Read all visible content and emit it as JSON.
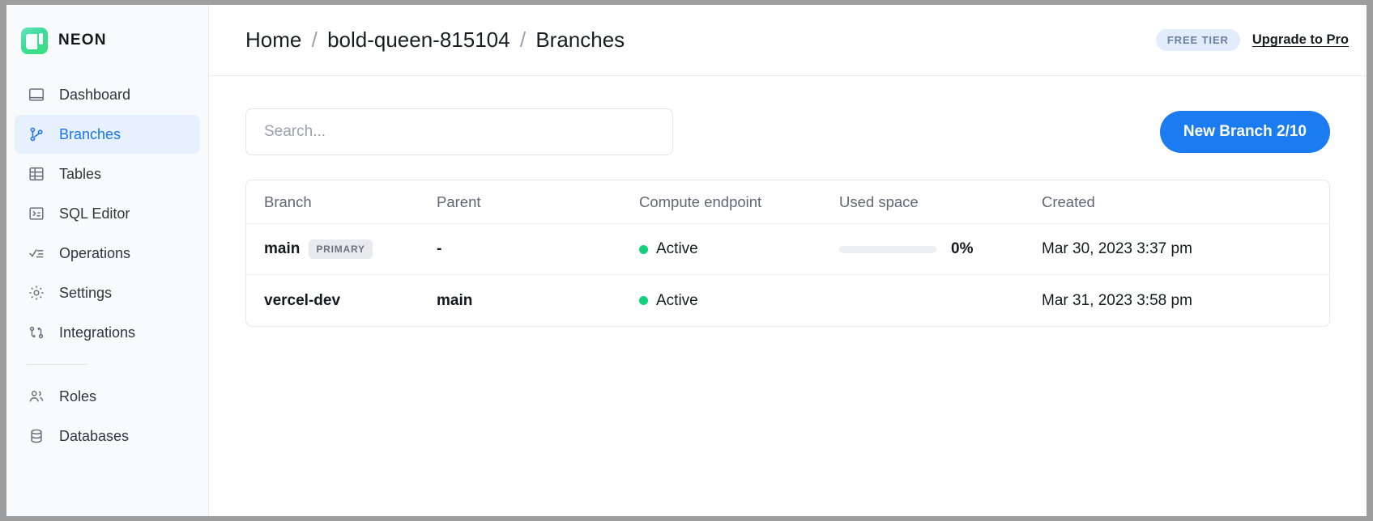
{
  "brand": {
    "name": "NEON",
    "logo_icon": "neon-logo-icon"
  },
  "sidebar": {
    "primary_items": [
      {
        "label": "Dashboard",
        "icon": "dashboard-icon",
        "active": false
      },
      {
        "label": "Branches",
        "icon": "branches-icon",
        "active": true
      },
      {
        "label": "Tables",
        "icon": "tables-icon",
        "active": false
      },
      {
        "label": "SQL Editor",
        "icon": "sql-editor-icon",
        "active": false
      },
      {
        "label": "Operations",
        "icon": "operations-icon",
        "active": false
      },
      {
        "label": "Settings",
        "icon": "gear-icon",
        "active": false
      },
      {
        "label": "Integrations",
        "icon": "integrations-icon",
        "active": false
      }
    ],
    "secondary_items": [
      {
        "label": "Roles",
        "icon": "users-icon",
        "active": false
      },
      {
        "label": "Databases",
        "icon": "database-icon",
        "active": false
      }
    ]
  },
  "topbar": {
    "breadcrumb": [
      "Home",
      "bold-queen-815104",
      "Branches"
    ],
    "separator": "/",
    "tier_badge": "FREE TIER",
    "upgrade_link": "Upgrade to Pro"
  },
  "toolbar": {
    "search_placeholder": "Search...",
    "search_value": "",
    "new_branch_label": "New Branch 2/10"
  },
  "table": {
    "columns": [
      "Branch",
      "Parent",
      "Compute endpoint",
      "Used space",
      "Created"
    ],
    "rows": [
      {
        "branch": "main",
        "badge": "PRIMARY",
        "parent": "-",
        "compute_status": "Active",
        "used_space_percent": 0,
        "used_space_label": "0%",
        "show_usage_bar": true,
        "created": "Mar 30, 2023 3:37 pm"
      },
      {
        "branch": "vercel-dev",
        "badge": "",
        "parent": "main",
        "compute_status": "Active",
        "used_space_percent": 0,
        "used_space_label": "",
        "show_usage_bar": false,
        "created": "Mar 31, 2023 3:58 pm"
      }
    ]
  },
  "colors": {
    "accent_blue": "#1a7cf0",
    "active_nav_bg": "#e6f0ff",
    "status_green": "#13cf7f",
    "brand_green": "#38e07b",
    "tier_badge_bg": "#e3ecfb"
  }
}
